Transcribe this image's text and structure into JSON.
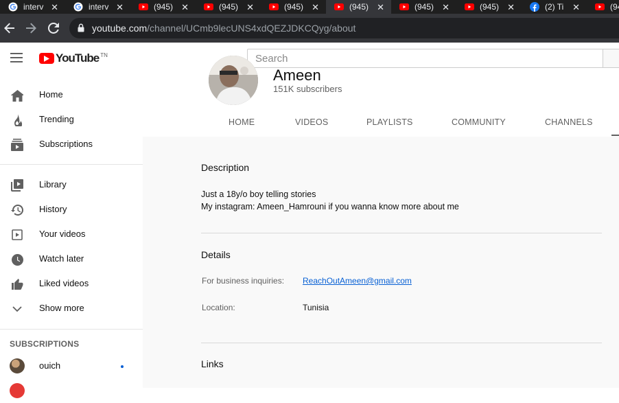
{
  "browser": {
    "tabs": [
      {
        "title": "interv",
        "favicon": "google-icon",
        "active": false
      },
      {
        "title": "interv",
        "favicon": "google-icon",
        "active": false
      },
      {
        "title": "(945)",
        "favicon": "youtube-icon",
        "active": false
      },
      {
        "title": "(945)",
        "favicon": "youtube-icon",
        "active": false
      },
      {
        "title": "(945)",
        "favicon": "youtube-icon",
        "active": false
      },
      {
        "title": "(945)",
        "favicon": "youtube-icon",
        "active": true
      },
      {
        "title": "(945)",
        "favicon": "youtube-icon",
        "active": false
      },
      {
        "title": "(945)",
        "favicon": "youtube-icon",
        "active": false
      },
      {
        "title": "(2) Ti",
        "favicon": "facebook-icon",
        "active": false
      },
      {
        "title": "(94",
        "favicon": "youtube-icon",
        "active": false
      }
    ],
    "url_host": "youtube.com",
    "url_path": "/channel/UCmb9lecUNS4xdQEZJDKCQyg/about"
  },
  "masthead": {
    "logo_text": "YouTube",
    "region_code": "TN",
    "search_placeholder": "Search"
  },
  "sidebar": {
    "primary": [
      {
        "label": "Home",
        "icon": "home-icon"
      },
      {
        "label": "Trending",
        "icon": "flame-icon"
      },
      {
        "label": "Subscriptions",
        "icon": "subscriptions-icon"
      }
    ],
    "secondary": [
      {
        "label": "Library",
        "icon": "library-icon"
      },
      {
        "label": "History",
        "icon": "history-icon"
      },
      {
        "label": "Your videos",
        "icon": "your-videos-icon"
      },
      {
        "label": "Watch later",
        "icon": "clock-icon"
      },
      {
        "label": "Liked videos",
        "icon": "thumbs-up-icon"
      },
      {
        "label": "Show more",
        "icon": "chevron-down-icon"
      }
    ],
    "subscriptions_heading": "SUBSCRIPTIONS",
    "subscriptions": [
      {
        "name": "ouich",
        "has_new": true
      }
    ]
  },
  "channel": {
    "name": "Ameen",
    "subscribers": "151K subscribers",
    "tabs": [
      "HOME",
      "VIDEOS",
      "PLAYLISTS",
      "COMMUNITY",
      "CHANNELS"
    ]
  },
  "about": {
    "description_heading": "Description",
    "description_lines": [
      "Just a 18y/o boy telling stories",
      "My instagram: Ameen_Hamrouni if you wanna know more about me"
    ],
    "details_heading": "Details",
    "details": [
      {
        "label": "For business inquiries:",
        "value": "ReachOutAmeen@gmail.com",
        "is_link": true
      },
      {
        "label": "Location:",
        "value": "Tunisia",
        "is_link": false
      }
    ],
    "links_heading": "Links"
  },
  "colors": {
    "youtube_red": "#ff0000",
    "link_blue": "#065fd4",
    "chrome_dark": "#35363a"
  }
}
